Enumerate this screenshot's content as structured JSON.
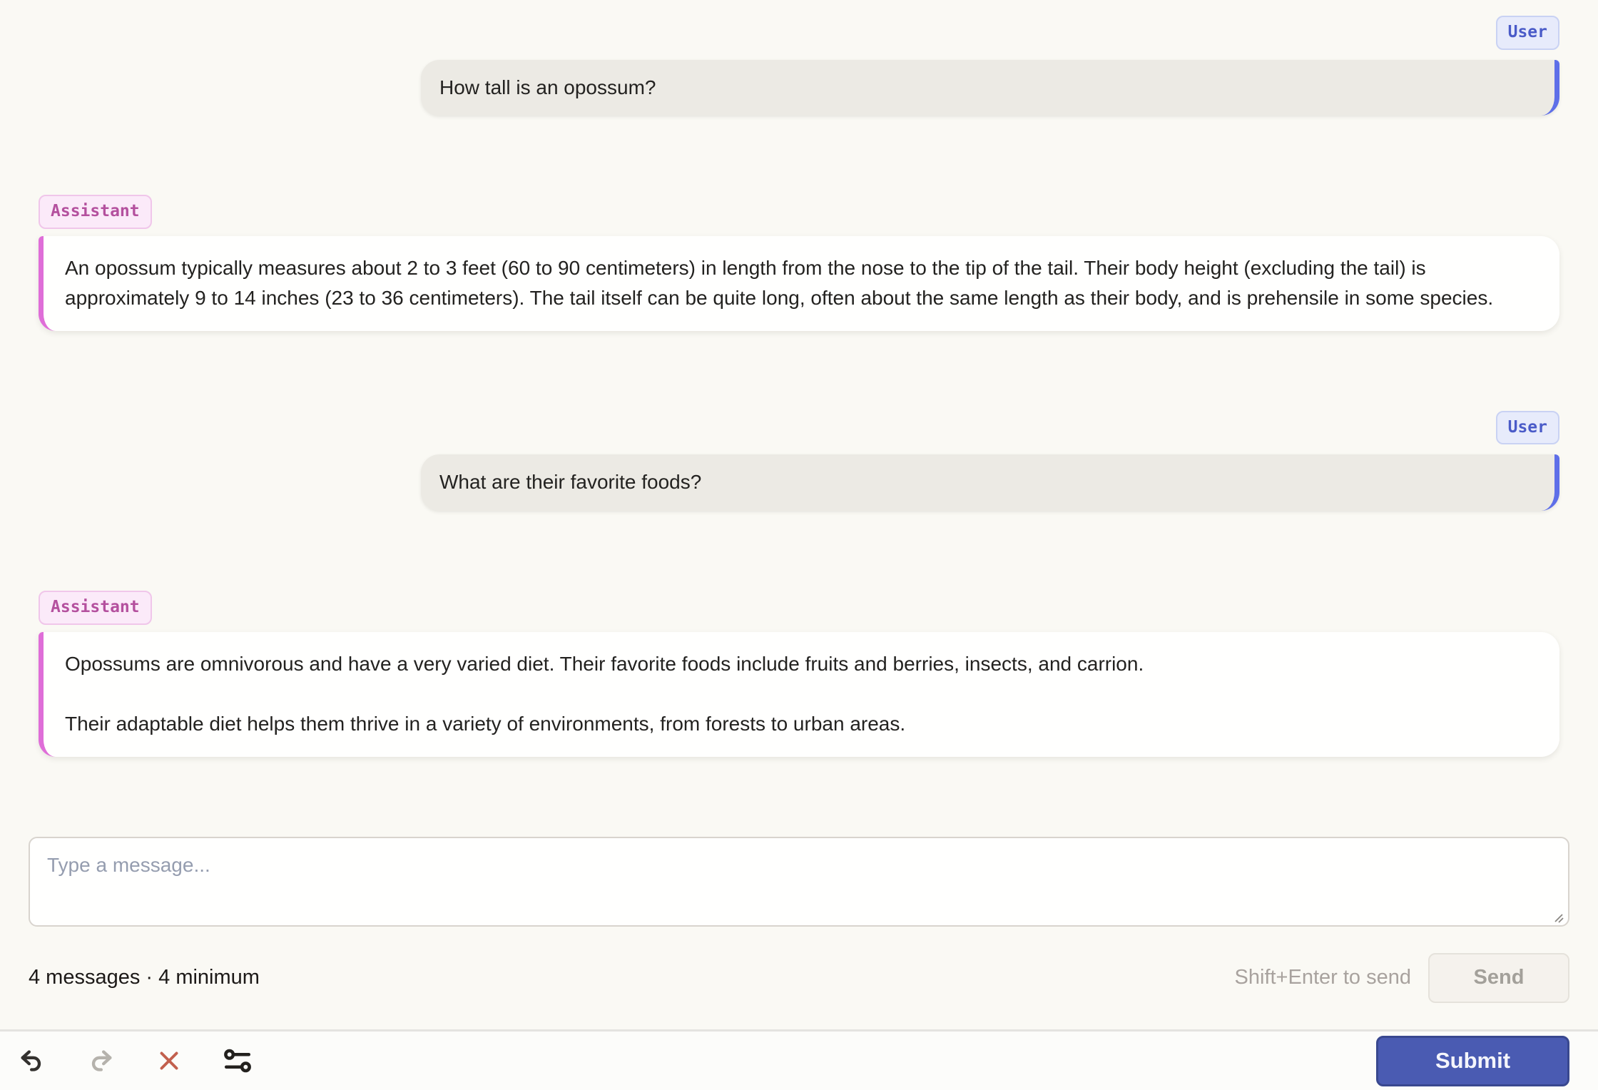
{
  "colors": {
    "user_accent": "#5E6FE8",
    "user_badge_text": "#4A5BC8",
    "assistant_accent": "#DF6ED8",
    "assistant_badge_text": "#B4509E",
    "submit_bg": "#4A5BB2",
    "clear_icon_color": "#C2604E"
  },
  "messages": [
    {
      "role_label": "User",
      "text": "How tall is an opossum?"
    },
    {
      "role_label": "Assistant",
      "paragraphs": [
        "An opossum typically measures about 2 to 3 feet (60 to 90 centimeters) in length from the nose to the tip of the tail. Their body height (excluding the tail) is approximately 9 to 14 inches (23 to 36 centimeters). The tail itself can be quite long, often about the same length as their body, and is prehensile in some species."
      ]
    },
    {
      "role_label": "User",
      "text": "What are their favorite foods?"
    },
    {
      "role_label": "Assistant",
      "paragraphs": [
        "Opossums are omnivorous and have a very varied diet. Their favorite foods include fruits and berries, insects, and carrion.",
        "Their adaptable diet helps them thrive in a variety of environments, from forests to urban areas."
      ]
    }
  ],
  "composer": {
    "placeholder": "Type a message...",
    "input_value": "",
    "status": "4 messages · 4 minimum",
    "hint": "Shift+Enter to send",
    "send_label": "Send"
  },
  "toolbar": {
    "icons": [
      "undo",
      "redo",
      "clear",
      "settings"
    ],
    "submit_label": "Submit"
  }
}
